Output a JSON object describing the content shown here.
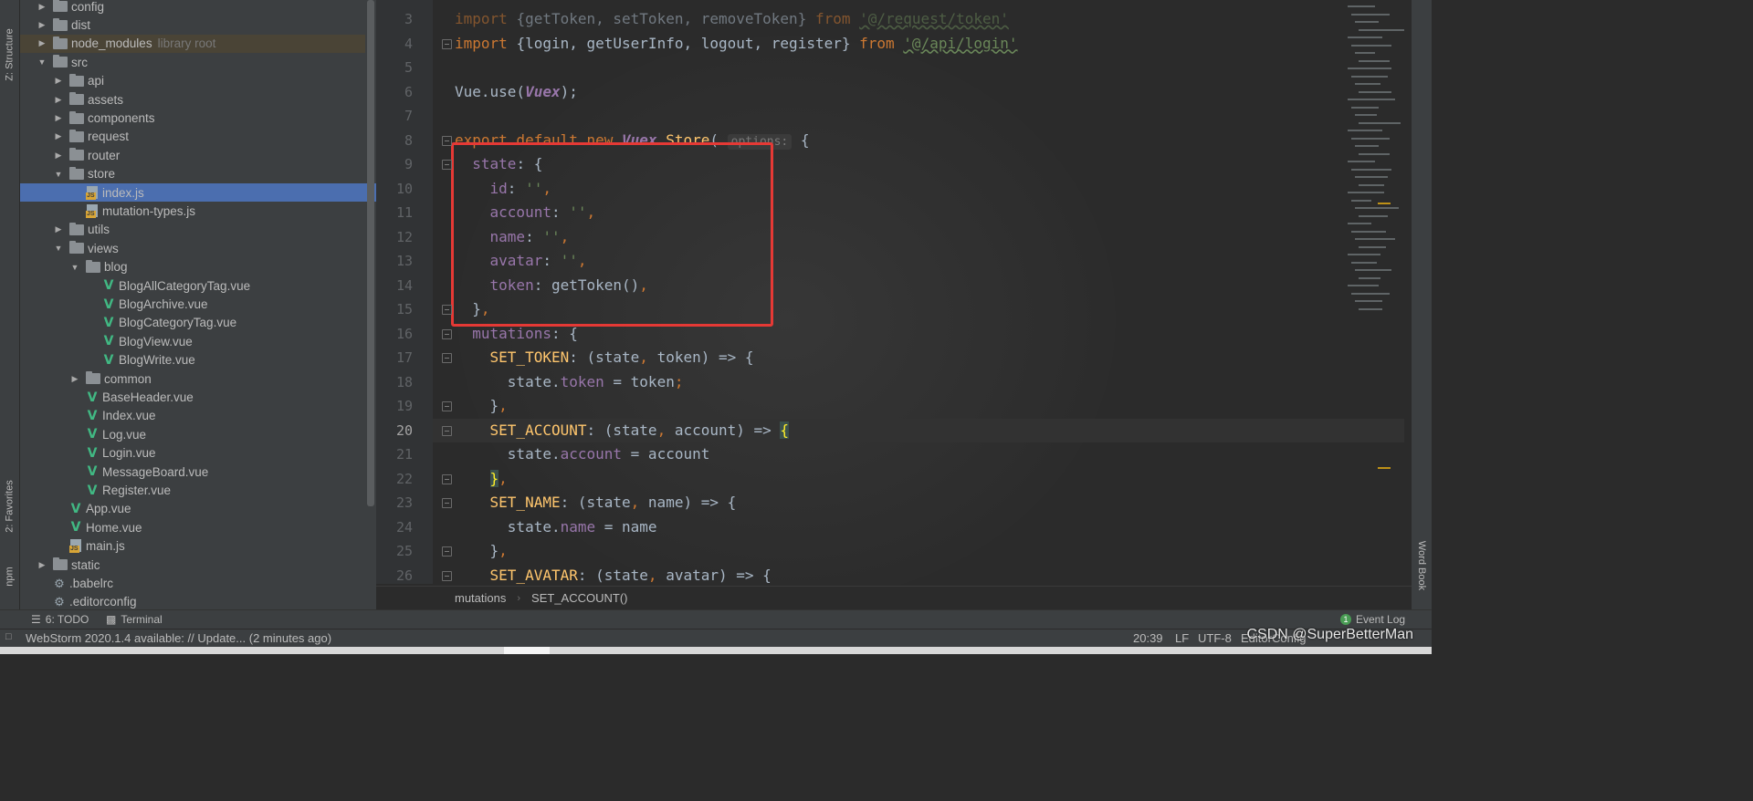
{
  "left_tabs": {
    "structure": "Z: Structure",
    "favorites": "2: Favorites",
    "npm": "npm"
  },
  "right_tabs": {
    "wordbook": "Word Book"
  },
  "tree": [
    {
      "label": "config",
      "type": "folder",
      "indent": 1,
      "twisty": "closed"
    },
    {
      "label": "dist",
      "type": "folder",
      "indent": 1,
      "twisty": "closed"
    },
    {
      "label": "node_modules",
      "hint": "library root",
      "type": "folder",
      "indent": 1,
      "twisty": "closed",
      "libroot": true
    },
    {
      "label": "src",
      "type": "folder",
      "indent": 1,
      "twisty": "open"
    },
    {
      "label": "api",
      "type": "folder",
      "indent": 2,
      "twisty": "closed"
    },
    {
      "label": "assets",
      "type": "folder",
      "indent": 2,
      "twisty": "closed"
    },
    {
      "label": "components",
      "type": "folder",
      "indent": 2,
      "twisty": "closed"
    },
    {
      "label": "request",
      "type": "folder",
      "indent": 2,
      "twisty": "closed"
    },
    {
      "label": "router",
      "type": "folder",
      "indent": 2,
      "twisty": "closed"
    },
    {
      "label": "store",
      "type": "folder",
      "indent": 2,
      "twisty": "open"
    },
    {
      "label": "index.js",
      "type": "js",
      "indent": 3,
      "selected": true
    },
    {
      "label": "mutation-types.js",
      "type": "js",
      "indent": 3
    },
    {
      "label": "utils",
      "type": "folder",
      "indent": 2,
      "twisty": "closed"
    },
    {
      "label": "views",
      "type": "folder",
      "indent": 2,
      "twisty": "open"
    },
    {
      "label": "blog",
      "type": "folder",
      "indent": 3,
      "twisty": "open"
    },
    {
      "label": "BlogAllCategoryTag.vue",
      "type": "vue",
      "indent": 4
    },
    {
      "label": "BlogArchive.vue",
      "type": "vue",
      "indent": 4
    },
    {
      "label": "BlogCategoryTag.vue",
      "type": "vue",
      "indent": 4
    },
    {
      "label": "BlogView.vue",
      "type": "vue",
      "indent": 4
    },
    {
      "label": "BlogWrite.vue",
      "type": "vue",
      "indent": 4
    },
    {
      "label": "common",
      "type": "folder",
      "indent": 3,
      "twisty": "closed"
    },
    {
      "label": "BaseHeader.vue",
      "type": "vue",
      "indent": 3
    },
    {
      "label": "Index.vue",
      "type": "vue",
      "indent": 3
    },
    {
      "label": "Log.vue",
      "type": "vue",
      "indent": 3
    },
    {
      "label": "Login.vue",
      "type": "vue",
      "indent": 3
    },
    {
      "label": "MessageBoard.vue",
      "type": "vue",
      "indent": 3
    },
    {
      "label": "Register.vue",
      "type": "vue",
      "indent": 3
    },
    {
      "label": "App.vue",
      "type": "vue",
      "indent": 2
    },
    {
      "label": "Home.vue",
      "type": "vue",
      "indent": 2
    },
    {
      "label": "main.js",
      "type": "js",
      "indent": 2
    },
    {
      "label": "static",
      "type": "folder",
      "indent": 1,
      "twisty": "closed"
    },
    {
      "label": ".babelrc",
      "type": "cfg",
      "indent": 1
    },
    {
      "label": ".editorconfig",
      "type": "cfg",
      "indent": 1
    }
  ],
  "editor": {
    "current_line": 20,
    "lines": [
      {
        "n": "3",
        "tokens": [
          [
            "kw",
            "import "
          ],
          [
            "p",
            "{getToken, setToken, removeToken} "
          ],
          [
            "kw",
            "from "
          ],
          [
            "strsq",
            "'@/request/token'"
          ]
        ]
      },
      {
        "n": "4",
        "tokens": [
          [
            "kw",
            "import "
          ],
          [
            "p",
            "{login, getUserInfo, logout, register} "
          ],
          [
            "kw",
            "from "
          ],
          [
            "strsq",
            "'@/api/login'"
          ]
        ]
      },
      {
        "n": "5",
        "tokens": []
      },
      {
        "n": "6",
        "tokens": [
          [
            "p",
            "Vue.use("
          ],
          [
            "cls",
            "Vuex"
          ],
          [
            "p",
            ");"
          ]
        ]
      },
      {
        "n": "7",
        "tokens": []
      },
      {
        "n": "8",
        "tokens": [
          [
            "kw",
            "export default new "
          ],
          [
            "cls",
            "Vuex"
          ],
          [
            "p",
            "."
          ],
          [
            "fn",
            "Store"
          ],
          [
            "p",
            "( "
          ],
          [
            "hint",
            "options:"
          ],
          [
            "p",
            " {"
          ]
        ]
      },
      {
        "n": "9",
        "tokens": [
          [
            "prop",
            "  state"
          ],
          [
            "p",
            ": {"
          ]
        ]
      },
      {
        "n": "10",
        "tokens": [
          [
            "prop",
            "    id"
          ],
          [
            "p",
            ": "
          ],
          [
            "str",
            "''"
          ],
          [
            "kw",
            ","
          ]
        ]
      },
      {
        "n": "11",
        "tokens": [
          [
            "prop",
            "    account"
          ],
          [
            "p",
            ": "
          ],
          [
            "str",
            "''"
          ],
          [
            "kw",
            ","
          ]
        ]
      },
      {
        "n": "12",
        "tokens": [
          [
            "prop",
            "    name"
          ],
          [
            "p",
            ": "
          ],
          [
            "str",
            "''"
          ],
          [
            "kw",
            ","
          ]
        ]
      },
      {
        "n": "13",
        "tokens": [
          [
            "prop",
            "    avatar"
          ],
          [
            "p",
            ": "
          ],
          [
            "str",
            "''"
          ],
          [
            "kw",
            ","
          ]
        ]
      },
      {
        "n": "14",
        "tokens": [
          [
            "prop",
            "    token"
          ],
          [
            "p",
            ": getToken()"
          ],
          [
            "kw",
            ","
          ]
        ]
      },
      {
        "n": "15",
        "tokens": [
          [
            "p",
            "  }"
          ],
          [
            "kw",
            ","
          ]
        ]
      },
      {
        "n": "16",
        "tokens": [
          [
            "prop",
            "  mutations"
          ],
          [
            "p",
            ": {"
          ]
        ]
      },
      {
        "n": "17",
        "tokens": [
          [
            "fn",
            "    SET_TOKEN"
          ],
          [
            "p",
            ": (state"
          ],
          [
            "kw",
            ", "
          ],
          [
            "p",
            "token) => {"
          ]
        ]
      },
      {
        "n": "18",
        "tokens": [
          [
            "p",
            "      state."
          ],
          [
            "prop",
            "token"
          ],
          [
            "p",
            " = token"
          ],
          [
            "kw",
            ";"
          ]
        ]
      },
      {
        "n": "19",
        "tokens": [
          [
            "p",
            "    }"
          ],
          [
            "kw",
            ","
          ]
        ]
      },
      {
        "n": "20",
        "tokens": [
          [
            "fn",
            "    SET_ACCOUNT"
          ],
          [
            "p",
            ": (state"
          ],
          [
            "kw",
            ", "
          ],
          [
            "p",
            "account) => "
          ],
          [
            "bh",
            "{"
          ]
        ]
      },
      {
        "n": "21",
        "tokens": [
          [
            "p",
            "      state."
          ],
          [
            "prop",
            "account"
          ],
          [
            "p",
            " = account"
          ]
        ]
      },
      {
        "n": "22",
        "tokens": [
          [
            "p",
            "    "
          ],
          [
            "bh",
            "}"
          ],
          [
            "kw",
            ","
          ]
        ]
      },
      {
        "n": "23",
        "tokens": [
          [
            "fn",
            "    SET_NAME"
          ],
          [
            "p",
            ": (state"
          ],
          [
            "kw",
            ", "
          ],
          [
            "p",
            "name) => {"
          ]
        ]
      },
      {
        "n": "24",
        "tokens": [
          [
            "p",
            "      state."
          ],
          [
            "prop",
            "name"
          ],
          [
            "p",
            " = name"
          ]
        ]
      },
      {
        "n": "25",
        "tokens": [
          [
            "p",
            "    }"
          ],
          [
            "kw",
            ","
          ]
        ]
      },
      {
        "n": "26",
        "tokens": [
          [
            "fn",
            "    SET_AVATAR"
          ],
          [
            "p",
            ": (state"
          ],
          [
            "kw",
            ", "
          ],
          [
            "p",
            "avatar) => {"
          ]
        ]
      }
    ]
  },
  "breadcrumb": [
    "mutations",
    "SET_ACCOUNT()"
  ],
  "toolbar": {
    "todo": "6: TODO",
    "terminal": "Terminal",
    "event_log": "Event Log",
    "event_count": "1"
  },
  "status": {
    "message": "WebStorm 2020.1.4 available: // Update... (2 minutes ago)",
    "position": "20:39",
    "line_sep": "LF",
    "encoding": "UTF-8",
    "editorconfig": "EditorConfig"
  },
  "watermark": "CSDN @SuperBetterMan",
  "colors": {
    "selection": "#4b6eaf",
    "highlight_box": "#e53935",
    "vue_icon": "#41b883"
  }
}
